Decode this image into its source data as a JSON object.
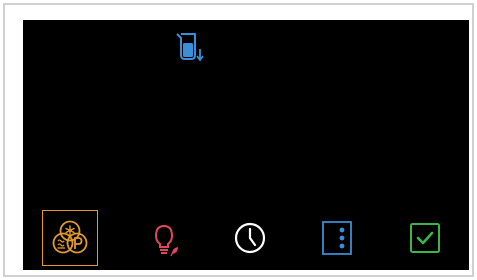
{
  "status": {
    "icon": "water-tank-empty-icon",
    "color": "#3a8fd8"
  },
  "bottom_bar": {
    "buttons": [
      {
        "name": "bean-mode-button",
        "icon": "bean-snowflake-p-icon",
        "color": "#e39a2c",
        "selected": true
      },
      {
        "name": "light-eco-button",
        "icon": "lightbulb-leaf-icon",
        "color": "#e0475f",
        "selected": false
      },
      {
        "name": "timer-button",
        "icon": "clock-icon",
        "color": "#ffffff",
        "selected": false
      },
      {
        "name": "menu-button",
        "icon": "vertical-dots-icon",
        "color": "#3a8fd8",
        "selected": false
      },
      {
        "name": "confirm-button",
        "icon": "checkbox-check-icon",
        "color": "#3ab54a",
        "selected": false
      }
    ]
  }
}
